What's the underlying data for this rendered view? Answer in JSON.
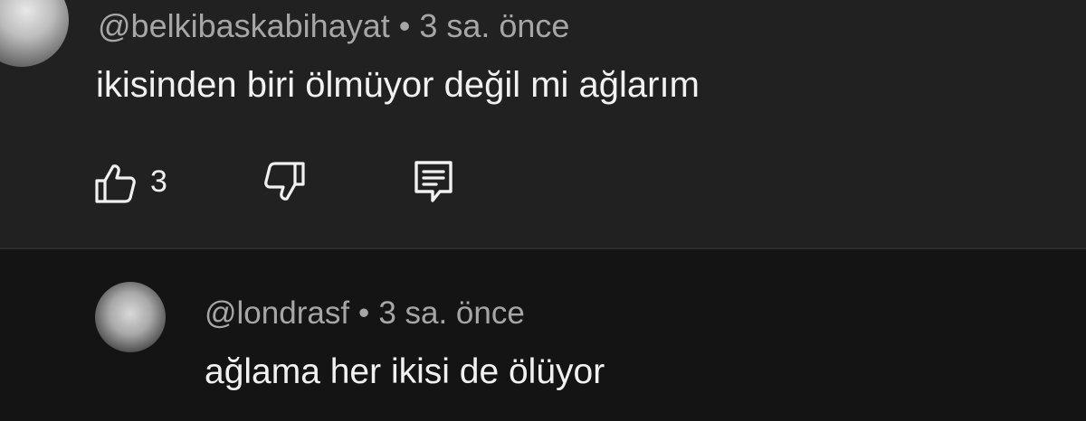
{
  "comment": {
    "author": "@belkibaskabihayat",
    "separator": "•",
    "time": "3 sa. önce",
    "text": "ikisinden biri ölmüyor değil mi ağlarım",
    "like_count": "3",
    "icons": {
      "like": "thumbs-up-icon",
      "dislike": "thumbs-down-icon",
      "reply": "reply-comment-icon"
    }
  },
  "reply": {
    "author": "@londrasf",
    "separator": "•",
    "time": "3 sa. önce",
    "text": "ağlama her ikisi de ölüyor"
  },
  "colors": {
    "comment_bg": "#212121",
    "reply_bg": "#141414",
    "text": "#f1f1f1",
    "meta": "#a6a6a6"
  }
}
